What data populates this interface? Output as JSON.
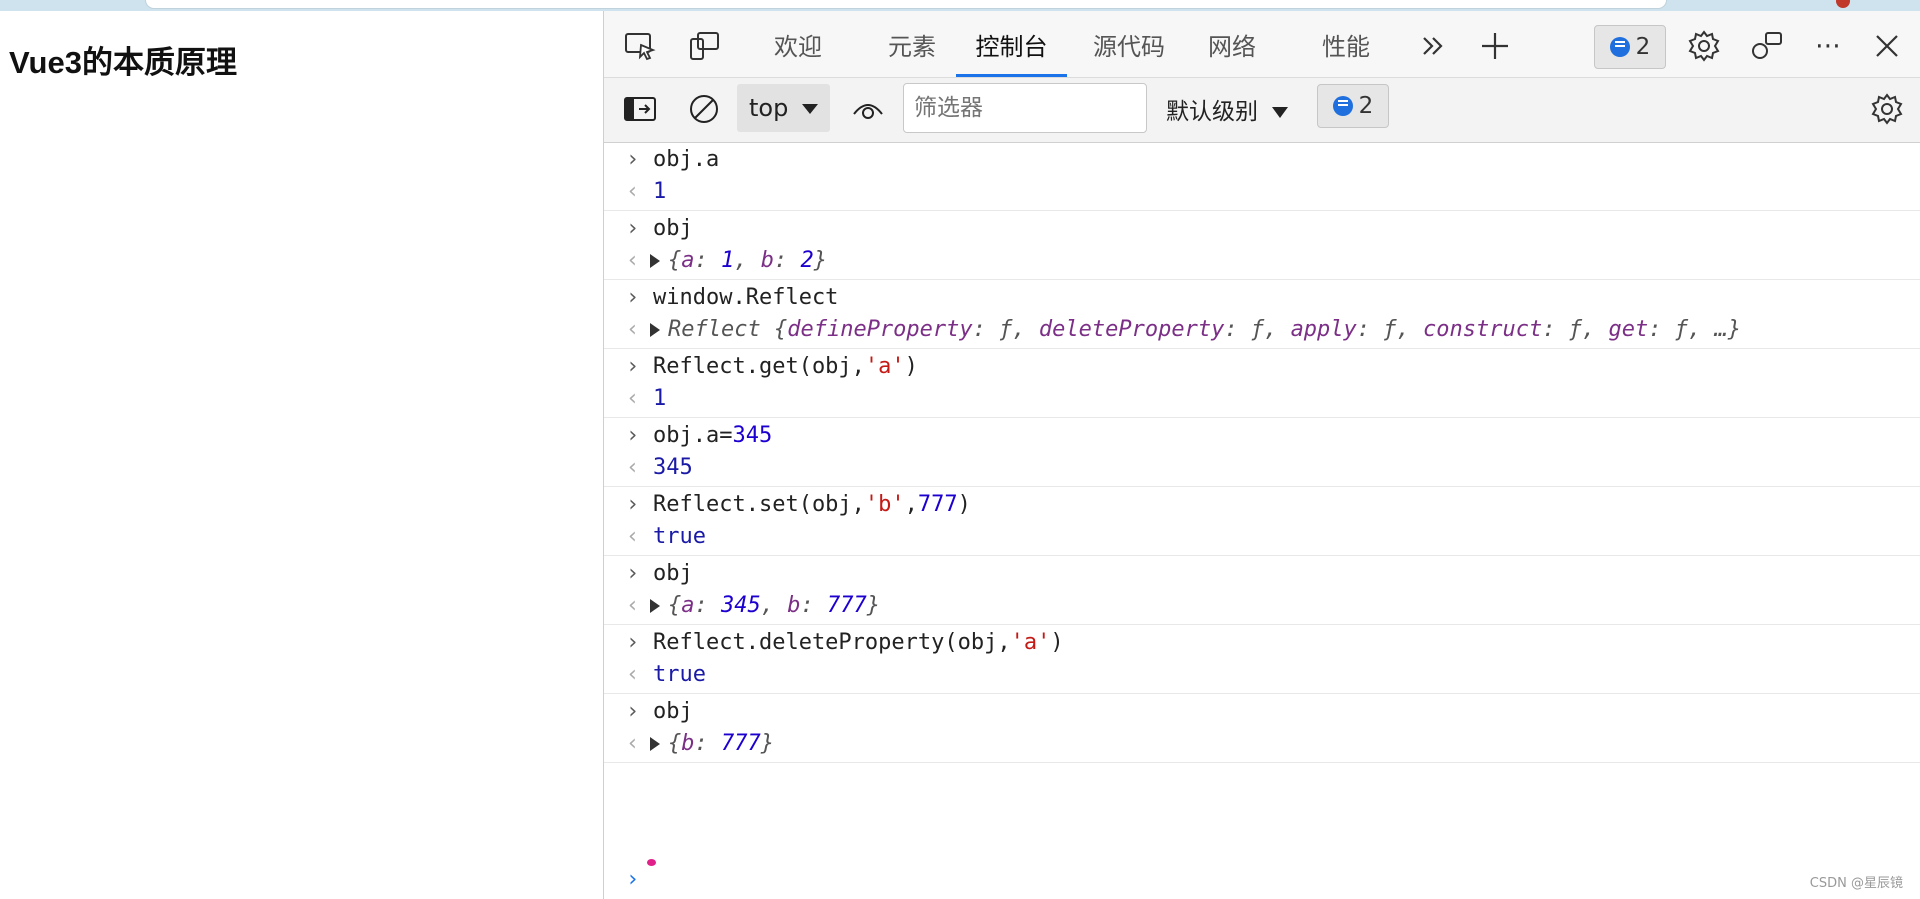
{
  "page": {
    "title": "Vue3的本质原理"
  },
  "devtools": {
    "tabs": [
      "欢迎",
      "元素",
      "控制台",
      "源代码",
      "网络",
      "性能"
    ],
    "active_tab": "控制台",
    "issues_count": "2"
  },
  "toolbar": {
    "context": "top",
    "filter_placeholder": "筛选器",
    "levels": "默认级别",
    "issues_count": "2"
  },
  "console": [
    {
      "input": [
        [
          "plain",
          "obj.a"
        ]
      ],
      "output": [
        [
          "res",
          "1"
        ]
      ]
    },
    {
      "input": [
        [
          "plain",
          "obj"
        ]
      ],
      "output_obj": [
        [
          "{",
          ""
        ],
        [
          "k",
          "a"
        ],
        [
          ":",
          " "
        ],
        [
          "v",
          "1"
        ],
        [
          ", ",
          ""
        ],
        [
          "k",
          "b"
        ],
        [
          ":",
          " "
        ],
        [
          "v",
          "2"
        ],
        [
          "}",
          ""
        ]
      ]
    },
    {
      "input": [
        [
          "plain",
          "window.Reflect"
        ]
      ],
      "output_reflect": "Reflect {defineProperty: ƒ, deleteProperty: ƒ, apply: ƒ, construct: ƒ, get: ƒ, …}"
    },
    {
      "input": [
        [
          "plain",
          "Reflect.get(obj,"
        ],
        [
          "str",
          "'a'"
        ],
        [
          "plain",
          ")"
        ]
      ],
      "output": [
        [
          "res",
          "1"
        ]
      ]
    },
    {
      "input": [
        [
          "plain",
          "obj.a="
        ],
        [
          "num",
          "345"
        ]
      ],
      "output": [
        [
          "res",
          "345"
        ]
      ]
    },
    {
      "input": [
        [
          "plain",
          "Reflect.set(obj,"
        ],
        [
          "str",
          "'b'"
        ],
        [
          "plain",
          ","
        ],
        [
          "num",
          "777"
        ],
        [
          "plain",
          ")"
        ]
      ],
      "output": [
        [
          "res",
          "true"
        ]
      ]
    },
    {
      "input": [
        [
          "plain",
          "obj"
        ]
      ],
      "output_obj": [
        [
          "{",
          ""
        ],
        [
          "k",
          "a"
        ],
        [
          ":",
          " "
        ],
        [
          "v",
          "345"
        ],
        [
          ", ",
          ""
        ],
        [
          "k",
          "b"
        ],
        [
          ":",
          " "
        ],
        [
          "v",
          "777"
        ],
        [
          "}",
          ""
        ]
      ]
    },
    {
      "input": [
        [
          "plain",
          "Reflect.deleteProperty(obj,"
        ],
        [
          "str",
          "'a'"
        ],
        [
          "plain",
          ")"
        ]
      ],
      "output": [
        [
          "res",
          "true"
        ]
      ]
    },
    {
      "input": [
        [
          "plain",
          "obj"
        ]
      ],
      "output_obj": [
        [
          "{",
          ""
        ],
        [
          "k",
          "b"
        ],
        [
          ":",
          " "
        ],
        [
          "v",
          "777"
        ],
        [
          "}",
          ""
        ]
      ]
    }
  ],
  "watermark": "CSDN @星辰镜"
}
